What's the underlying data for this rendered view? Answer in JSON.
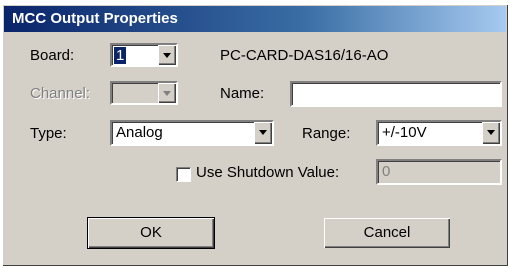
{
  "window": {
    "title": "MCC Output Properties"
  },
  "board": {
    "label": "Board:",
    "value": "1",
    "device_name": "PC-CARD-DAS16/16-AO"
  },
  "channel": {
    "label": "Channel:",
    "value": ""
  },
  "name": {
    "label": "Name:",
    "value": ""
  },
  "type": {
    "label": "Type:",
    "value": "Analog"
  },
  "range": {
    "label": "Range:",
    "value": "+/-10V"
  },
  "shutdown": {
    "label": "Use Shutdown Value:",
    "checked": false,
    "value": "0"
  },
  "buttons": {
    "ok": "OK",
    "cancel": "Cancel"
  },
  "colors": {
    "face": "#d4d0c8",
    "title_start": "#0a246a",
    "title_end": "#a6caf0",
    "selection": "#0a246a"
  }
}
